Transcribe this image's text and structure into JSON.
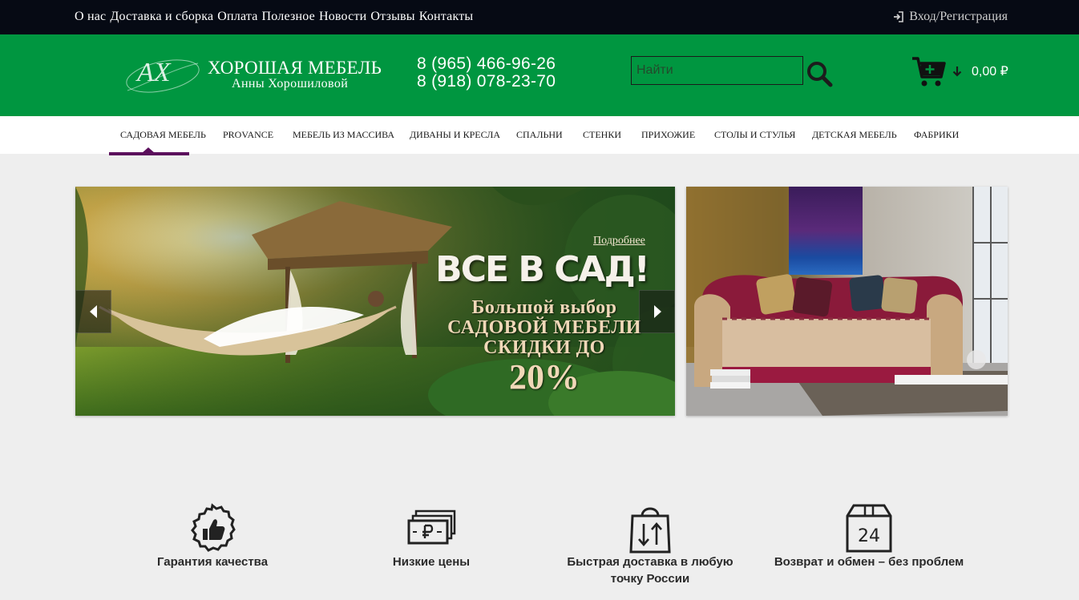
{
  "topbar": {
    "nav": [
      "О нас",
      "Доставка и сборка",
      "Оплата",
      "Полезное",
      "Новости",
      "Отзывы",
      "Контакты"
    ],
    "login_label": "Вход/Регистрация"
  },
  "header": {
    "logo_title": "ХОРОШАЯ МЕБЕЛЬ",
    "logo_subtitle": "Анны Хорошиловой",
    "logo_monogram": "АХ",
    "phones": [
      "8 (965) 466-96-26",
      "8 (918) 078-23-70"
    ],
    "search_placeholder": "Найти",
    "cart_total": "0,00 ₽"
  },
  "categories": [
    "Садовая мебель",
    "Provance",
    "Мебель из массива",
    "Диваны и кресла",
    "Спальни",
    "Стенки",
    "Прихожие",
    "Столы и стулья",
    "Детская мебель",
    "Фабрики"
  ],
  "slider": {
    "more_link": "Подробнее",
    "title": "ВСЕ В САД!",
    "line1": "Большой выбор",
    "line2": "САДОВОЙ МЕБЕЛИ",
    "line3": "СКИДКИ ДО",
    "percent": "20%"
  },
  "features": [
    {
      "label": "Гарантия качества",
      "icon": "thumbs-up-badge-icon"
    },
    {
      "label": "Низкие цены",
      "icon": "ruble-banknotes-icon"
    },
    {
      "label": "Быстрая доставка в любую точку России",
      "icon": "shopping-bag-arrows-icon"
    },
    {
      "label": "Возврат и обмен – без проблем",
      "icon": "box-24-icon"
    }
  ],
  "colors": {
    "topbar_bg": "#060a14",
    "header_green": "#009640",
    "active_category": "#5b0e5c",
    "page_bg": "#eeeeee"
  }
}
